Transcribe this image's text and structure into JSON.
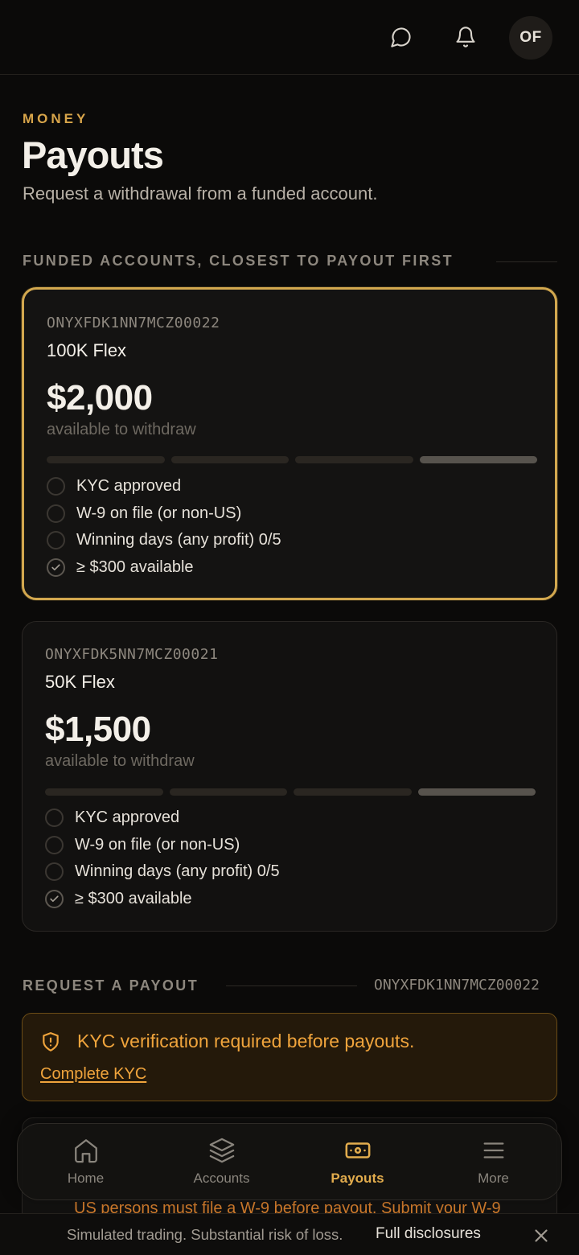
{
  "header": {
    "avatar_initials": "OF"
  },
  "page": {
    "eyebrow": "MONEY",
    "title": "Payouts",
    "subtitle": "Request a withdrawal from a funded account."
  },
  "funded_section": {
    "label": "FUNDED ACCOUNTS, CLOSEST TO PAYOUT FIRST",
    "accounts": [
      {
        "id": "ONYXFDK1NN7MCZ00022",
        "name": "100K Flex",
        "amount": "$2,000",
        "caption": "available to withdraw",
        "selected": true,
        "progress_completed": 1,
        "progress_total": 4,
        "checklist": [
          {
            "label": "KYC approved",
            "done": false
          },
          {
            "label": "W-9 on file (or non-US)",
            "done": false
          },
          {
            "label": "Winning days (any profit) 0/5",
            "done": false
          },
          {
            "label": "≥ $300 available",
            "done": true
          }
        ]
      },
      {
        "id": "ONYXFDK5NN7MCZ00021",
        "name": "50K Flex",
        "amount": "$1,500",
        "caption": "available to withdraw",
        "selected": false,
        "progress_completed": 1,
        "progress_total": 4,
        "checklist": [
          {
            "label": "KYC approved",
            "done": false
          },
          {
            "label": "W-9 on file (or non-US)",
            "done": false
          },
          {
            "label": "Winning days (any profit) 0/5",
            "done": false
          },
          {
            "label": "≥ $300 available",
            "done": true
          }
        ]
      }
    ]
  },
  "request_section": {
    "label": "REQUEST A PAYOUT",
    "account_id": "ONYXFDK1NN7MCZ00022",
    "alert": {
      "title": "KYC verification required before payouts.",
      "link": "Complete KYC"
    },
    "w9_notice": "US persons must file a W-9 before payout. Submit your W-9"
  },
  "nav": {
    "items": [
      {
        "label": "Home",
        "icon": "home-icon"
      },
      {
        "label": "Accounts",
        "icon": "layers-icon"
      },
      {
        "label": "Payouts",
        "icon": "banknote-icon",
        "active": true
      },
      {
        "label": "More",
        "icon": "menu-icon"
      }
    ]
  },
  "disclosure": {
    "text": "Simulated trading. Substantial risk of loss.",
    "link": "Full disclosures"
  },
  "colors": {
    "accent": "#d8a54a",
    "warning": "#f0a43c",
    "background": "#0b0a09",
    "card": "#121110"
  }
}
